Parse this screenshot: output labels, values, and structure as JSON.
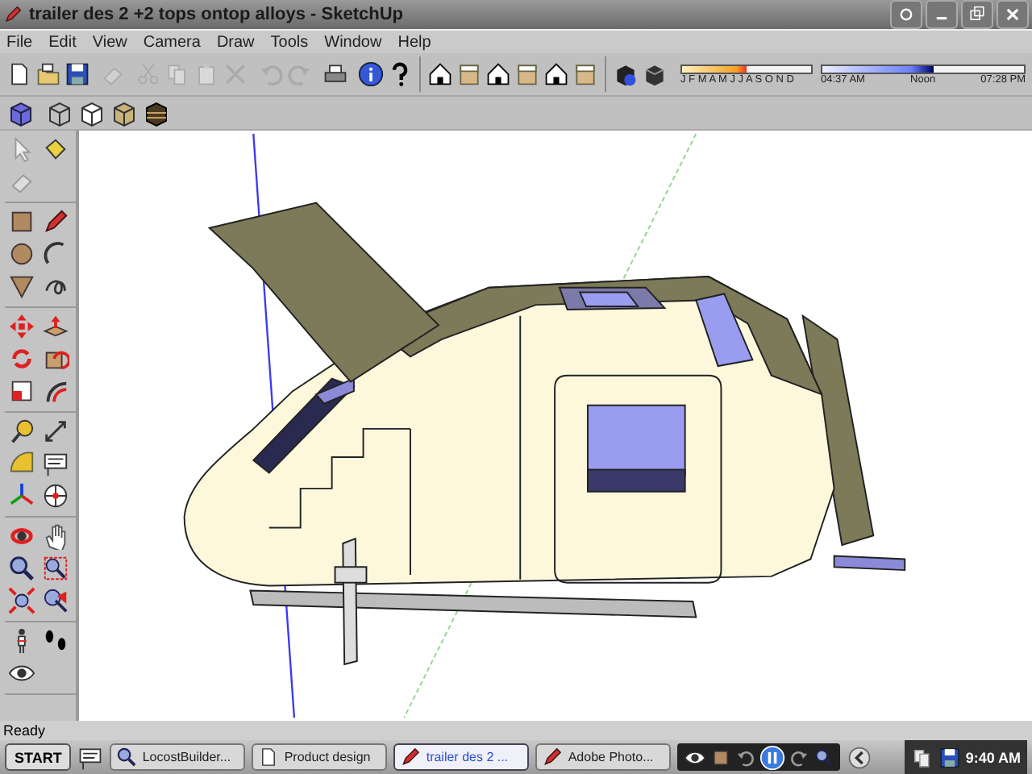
{
  "window": {
    "title": "trailer des 2 +2 tops ontop alloys - SketchUp"
  },
  "menu": [
    "File",
    "Edit",
    "View",
    "Camera",
    "Draw",
    "Tools",
    "Window",
    "Help"
  ],
  "shadow_settings": {
    "month_slider": {
      "level": 0.5
    },
    "months": "J F M A M J J A S O N D",
    "time_slider": {
      "level": 0.55
    },
    "time_start": "04:37 AM",
    "time_mid": "Noon",
    "time_end": "07:28 PM"
  },
  "status_bar": {
    "text": "Ready"
  },
  "taskbar": {
    "start": "START",
    "tasks": [
      {
        "label": "LocostBuilder...",
        "selected": false
      },
      {
        "label": "Product design",
        "selected": false
      },
      {
        "label": "trailer des 2 ...",
        "selected": true
      },
      {
        "label": "Adobe Photo...",
        "selected": false
      }
    ],
    "clock": "9:40 AM"
  }
}
